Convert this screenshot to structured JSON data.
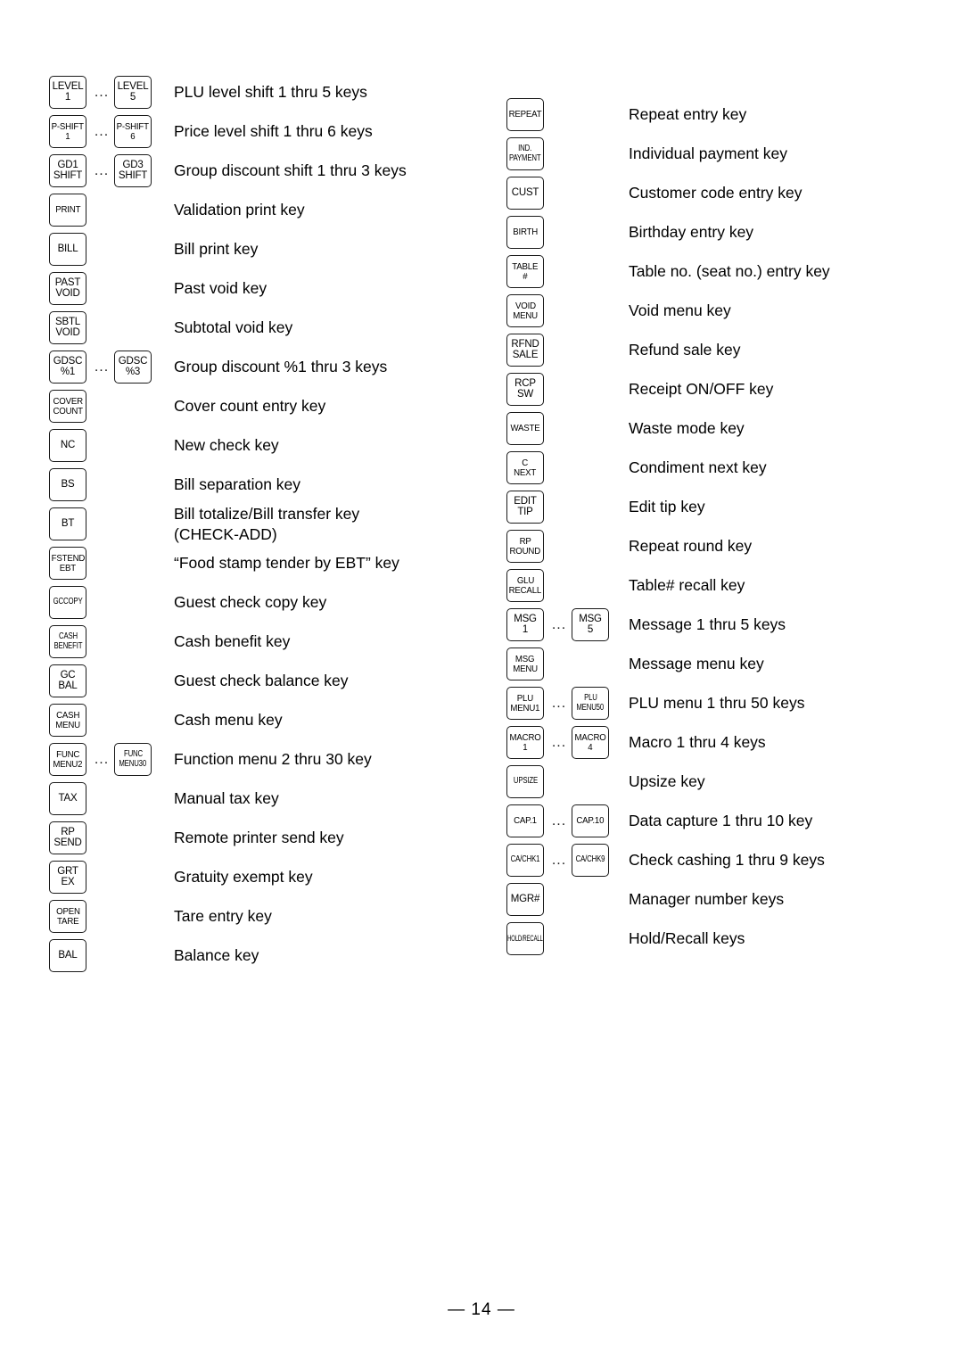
{
  "page": {
    "footer": "— 14 —"
  },
  "columns": {
    "left": {
      "rows": [
        {
          "keys": [
            {
              "lines": [
                "LEVEL",
                "1"
              ]
            },
            {
              "lines": [
                "LEVEL",
                "5"
              ]
            }
          ],
          "ellipsis": "...",
          "desc": "PLU level shift 1 thru 5 keys"
        },
        {
          "keys": [
            {
              "lines": [
                "P-SHIFT",
                "1"
              ],
              "fit": "sq"
            },
            {
              "lines": [
                "P-SHIFT",
                "6"
              ],
              "fit": "sq"
            }
          ],
          "ellipsis": "...",
          "desc": "Price level shift 1 thru 6 keys"
        },
        {
          "keys": [
            {
              "lines": [
                "GD1",
                "SHIFT"
              ]
            },
            {
              "lines": [
                "GD3",
                "SHIFT"
              ]
            }
          ],
          "ellipsis": "...",
          "desc": "Group discount shift 1 thru 3 keys"
        },
        {
          "keys": [
            {
              "lines": [
                "PRINT"
              ],
              "fit": "sq"
            }
          ],
          "ellipsis": "",
          "desc": "Validation print key"
        },
        {
          "keys": [
            {
              "lines": [
                "BILL"
              ]
            }
          ],
          "ellipsis": "",
          "desc": "Bill print key"
        },
        {
          "keys": [
            {
              "lines": [
                "PAST",
                "VOID"
              ]
            }
          ],
          "ellipsis": "",
          "desc": "Past void key"
        },
        {
          "keys": [
            {
              "lines": [
                "SBTL",
                "VOID"
              ]
            }
          ],
          "ellipsis": "",
          "desc": "Subtotal void key"
        },
        {
          "keys": [
            {
              "lines": [
                "GDSC",
                "%1"
              ]
            },
            {
              "lines": [
                "GDSC",
                "%3"
              ]
            }
          ],
          "ellipsis": "...",
          "desc": "Group discount %1 thru 3 keys"
        },
        {
          "keys": [
            {
              "lines": [
                "COVER",
                "COUNT"
              ],
              "fit": "sq"
            }
          ],
          "ellipsis": "",
          "desc": "Cover count entry key"
        },
        {
          "keys": [
            {
              "lines": [
                "NC"
              ]
            }
          ],
          "ellipsis": "",
          "desc": "New check key"
        },
        {
          "keys": [
            {
              "lines": [
                "BS"
              ]
            }
          ],
          "ellipsis": "",
          "desc": "Bill separation key"
        },
        {
          "keys": [
            {
              "lines": [
                "BT"
              ]
            }
          ],
          "ellipsis": "",
          "desc": "Bill totalize/Bill transfer key\n(CHECK-ADD)"
        },
        {
          "keys": [
            {
              "lines": [
                "FSTEND",
                "EBT"
              ],
              "fit": "sq"
            }
          ],
          "ellipsis": "",
          "desc": "“Food stamp tender by EBT” key"
        },
        {
          "keys": [
            {
              "lines": [
                "GCCOPY"
              ],
              "fit": "narrow"
            }
          ],
          "ellipsis": "",
          "desc": "Guest check copy key"
        },
        {
          "keys": [
            {
              "lines": [
                "CASH",
                "BENEFIT"
              ],
              "fit": "narrow"
            }
          ],
          "ellipsis": "",
          "desc": "Cash benefit key"
        },
        {
          "keys": [
            {
              "lines": [
                "GC",
                "BAL"
              ]
            }
          ],
          "ellipsis": "",
          "desc": "Guest check balance key"
        },
        {
          "keys": [
            {
              "lines": [
                "CASH",
                "MENU"
              ],
              "fit": "sq"
            }
          ],
          "ellipsis": "",
          "desc": "Cash menu key"
        },
        {
          "keys": [
            {
              "lines": [
                "FUNC",
                "MENU2"
              ],
              "fit": "sq"
            },
            {
              "lines": [
                "FUNC",
                "MENU30"
              ],
              "fit": "narrow"
            }
          ],
          "ellipsis": "...",
          "desc": "Function menu 2 thru 30 key"
        },
        {
          "keys": [
            {
              "lines": [
                "TAX"
              ]
            }
          ],
          "ellipsis": "",
          "desc": "Manual tax key"
        },
        {
          "keys": [
            {
              "lines": [
                "RP",
                "SEND"
              ]
            }
          ],
          "ellipsis": "",
          "desc": "Remote printer send key"
        },
        {
          "keys": [
            {
              "lines": [
                "GRT",
                "EX"
              ]
            }
          ],
          "ellipsis": "",
          "desc": "Gratuity exempt key"
        },
        {
          "keys": [
            {
              "lines": [
                "OPEN",
                "TARE"
              ],
              "fit": "sq"
            }
          ],
          "ellipsis": "",
          "desc": "Tare entry key"
        },
        {
          "keys": [
            {
              "lines": [
                "BAL"
              ]
            }
          ],
          "ellipsis": "",
          "desc": "Balance key"
        }
      ]
    },
    "right": {
      "rows": [
        {
          "keys": [
            {
              "lines": [
                "REPEAT"
              ],
              "fit": "sq"
            }
          ],
          "ellipsis": "",
          "desc": "Repeat entry key"
        },
        {
          "keys": [
            {
              "lines": [
                "IND.",
                "PAYMENT"
              ],
              "fit": "narrow"
            }
          ],
          "ellipsis": "",
          "desc": "Individual payment key"
        },
        {
          "keys": [
            {
              "lines": [
                "CUST"
              ]
            }
          ],
          "ellipsis": "",
          "desc": "Customer code entry key"
        },
        {
          "keys": [
            {
              "lines": [
                "BIRTH"
              ],
              "fit": "sq"
            }
          ],
          "ellipsis": "",
          "desc": "Birthday entry key"
        },
        {
          "keys": [
            {
              "lines": [
                "TABLE",
                "#"
              ],
              "fit": "sq"
            }
          ],
          "ellipsis": "",
          "desc": "Table no. (seat no.) entry key"
        },
        {
          "keys": [
            {
              "lines": [
                "VOID",
                "MENU"
              ],
              "fit": "sq"
            }
          ],
          "ellipsis": "",
          "desc": "Void menu key"
        },
        {
          "keys": [
            {
              "lines": [
                "RFND",
                "SALE"
              ]
            }
          ],
          "ellipsis": "",
          "desc": "Refund sale key"
        },
        {
          "keys": [
            {
              "lines": [
                "RCP",
                "SW"
              ]
            }
          ],
          "ellipsis": "",
          "desc": "Receipt ON/OFF key"
        },
        {
          "keys": [
            {
              "lines": [
                "WASTE"
              ],
              "fit": "sq"
            }
          ],
          "ellipsis": "",
          "desc": "Waste mode key"
        },
        {
          "keys": [
            {
              "lines": [
                "C",
                "NEXT"
              ],
              "fit": "sq"
            }
          ],
          "ellipsis": "",
          "desc": "Condiment next key"
        },
        {
          "keys": [
            {
              "lines": [
                "EDIT",
                "TIP"
              ]
            }
          ],
          "ellipsis": "",
          "desc": "Edit tip key"
        },
        {
          "keys": [
            {
              "lines": [
                "RP",
                "ROUND"
              ],
              "fit": "sq"
            }
          ],
          "ellipsis": "",
          "desc": "Repeat round key"
        },
        {
          "keys": [
            {
              "lines": [
                "GLU",
                "RECALL"
              ],
              "fit": "sq"
            }
          ],
          "ellipsis": "",
          "desc": "Table# recall key"
        },
        {
          "keys": [
            {
              "lines": [
                "MSG",
                "1"
              ]
            },
            {
              "lines": [
                "MSG",
                "5"
              ]
            }
          ],
          "ellipsis": "...",
          "desc": "Message 1 thru 5 keys"
        },
        {
          "keys": [
            {
              "lines": [
                "MSG",
                "MENU"
              ],
              "fit": "sq"
            }
          ],
          "ellipsis": "",
          "desc": "Message menu key"
        },
        {
          "keys": [
            {
              "lines": [
                "PLU",
                "MENU1"
              ],
              "fit": "sq"
            },
            {
              "lines": [
                "PLU",
                "MENU50"
              ],
              "fit": "narrow"
            }
          ],
          "ellipsis": "...",
          "desc": "PLU menu 1 thru 50 keys"
        },
        {
          "keys": [
            {
              "lines": [
                "MACRO",
                "1"
              ],
              "fit": "sq"
            },
            {
              "lines": [
                "MACRO",
                "4"
              ],
              "fit": "sq"
            }
          ],
          "ellipsis": "...",
          "desc": "Macro 1 thru 4 keys"
        },
        {
          "keys": [
            {
              "lines": [
                "UPSIZE"
              ],
              "fit": "narrow"
            }
          ],
          "ellipsis": "",
          "desc": "Upsize key"
        },
        {
          "keys": [
            {
              "lines": [
                "CAP.1"
              ],
              "fit": "sq"
            },
            {
              "lines": [
                "CAP.10"
              ],
              "fit": "sq"
            }
          ],
          "ellipsis": "...",
          "desc": "Data capture 1 thru 10 key"
        },
        {
          "keys": [
            {
              "lines": [
                "CA/CHK1"
              ],
              "fit": "narrow"
            },
            {
              "lines": [
                "CA/CHK9"
              ],
              "fit": "narrow"
            }
          ],
          "ellipsis": "...",
          "desc": "Check cashing 1 thru 9 keys"
        },
        {
          "keys": [
            {
              "lines": [
                "MGR#"
              ]
            }
          ],
          "ellipsis": "",
          "desc": "Manager number keys"
        },
        {
          "keys": [
            {
              "lines": [
                "HOLD/RECALL"
              ],
              "fit": "tiny"
            }
          ],
          "ellipsis": "",
          "desc": "Hold/Recall keys"
        }
      ]
    }
  }
}
